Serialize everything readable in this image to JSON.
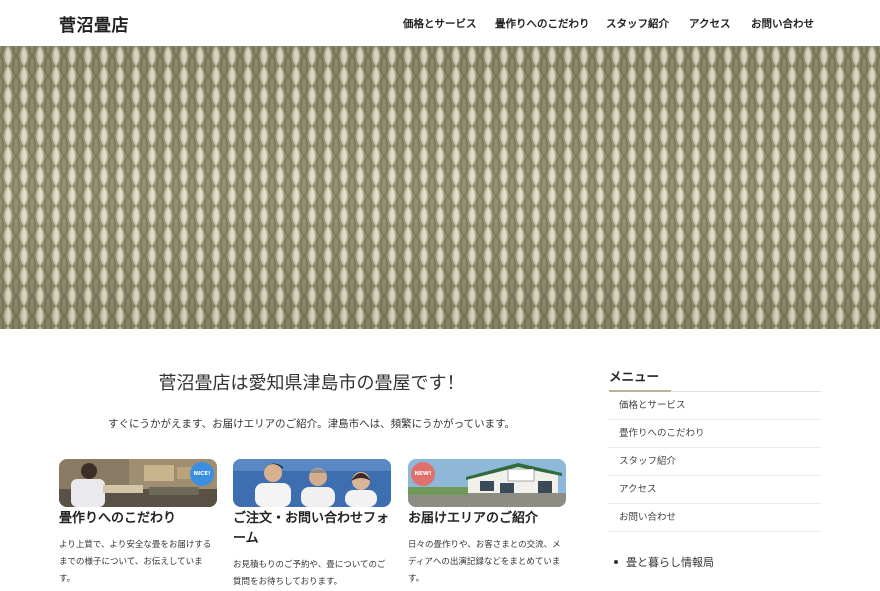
{
  "header": {
    "site_title": "菅沼畳店",
    "nav": [
      "価格とサービス",
      "畳作りへのこだわり",
      "スタッフ紹介",
      "アクセス",
      "お問い合わせ"
    ]
  },
  "main": {
    "title": "菅沼畳店は愛知県津島市の畳屋です！",
    "lead": "すぐにうかがえます、お届けエリアのご紹介。津島市へは、頻繁にうかがっています。",
    "cards": [
      {
        "title": "畳作りへのこだわり",
        "text": "より上質で、より安全な畳をお届けするまでの様子について、お伝えしています。",
        "badge": "NICE!"
      },
      {
        "title": "ご注文・お問い合わせフォーム",
        "text": "お見積もりのご予約や、畳についてのご質問をお待ちしております。"
      },
      {
        "title": "お届けエリアのご紹介",
        "text": "日々の畳作りや、お客さまとの交流、メディアへの出演記録などをまとめています。",
        "badge": "NEW!"
      }
    ]
  },
  "sidebar": {
    "heading": "メニュー",
    "items": [
      "価格とサービス",
      "畳作りへのこだわり",
      "スタッフ紹介",
      "アクセス",
      "お問い合わせ"
    ],
    "extra_link": "畳と暮らし情報局"
  },
  "colors": {
    "tatami_base": "#9c9a78",
    "tatami_highlight": "#d6d6c0",
    "tatami_shadow": "#6f6c52",
    "badge_blue": "#3a8fe0",
    "badge_red": "#e0706e",
    "accent_underline": "#b9b39b"
  }
}
